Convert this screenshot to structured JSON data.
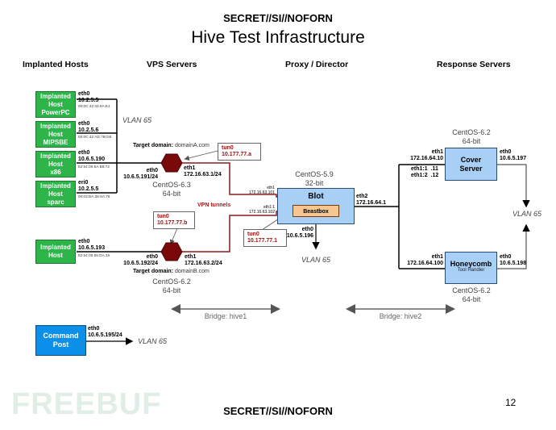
{
  "header": {
    "classification": "SECRET//SI//NOFORN",
    "title": "Hive Test Infrastructure"
  },
  "columns": {
    "implanted_hosts": "Implanted Hosts",
    "vps_servers": "VPS Servers",
    "proxy_director": "Proxy / Director",
    "response_servers": "Response Servers"
  },
  "implanted_hosts": [
    {
      "label": "Implanted Host PowerPC",
      "line1": "Implanted",
      "line2": "Host",
      "line3": "PowerPC",
      "iface": "eth0",
      "ip": "10.2.5.5",
      "mac": "00:0C:42:33:8A:E1"
    },
    {
      "label": "Implanted Host MIPSBE",
      "line1": "Implanted",
      "line2": "Host",
      "line3": "MIPSBE",
      "iface": "eth0",
      "ip": "10.2.5.6",
      "mac": "00:0C:42:AD:7B:DE"
    },
    {
      "label": "Implanted Host x86",
      "line1": "Implanted",
      "line2": "Host",
      "line3": "x86",
      "iface": "eth0",
      "ip": "10.6.5.190",
      "mac": "52:54:00:5A:B9:72"
    },
    {
      "label": "Implanted Host sparc",
      "line1": "Implanted",
      "line2": "Host",
      "line3": "sparc",
      "iface": "eri0",
      "ip": "10.2.5.5",
      "mac": "00:03:BA:36:5A:78"
    },
    {
      "label": "Implanted Host",
      "line1": "Implanted",
      "line2": "Host",
      "line3": "",
      "iface": "eth0",
      "ip": "10.6.5.193",
      "mac": "52:54:00:55:DA:16"
    }
  ],
  "vps": [
    {
      "target_label": "Target domain:",
      "target_domain": "domainA.com",
      "eth0_iface": "eth0",
      "eth0_ip": "10.6.5.191/24",
      "eth1_iface": "eth1",
      "eth1_ip": "172.16.63.1/24",
      "os": "CentOS-6.3",
      "arch": "64-bit",
      "tun_iface": "tun0",
      "tun_ip": "10.177.77.a"
    },
    {
      "target_label": "Target domain:",
      "target_domain": "domainB.com",
      "eth0_iface": "eth0",
      "eth0_ip": "10.6.5.192/24",
      "eth1_iface": "eth1",
      "eth1_ip": "172.16.63.2/24",
      "os": "CentOS-6.2",
      "arch": "64-bit",
      "tun_iface": "tun0",
      "tun_ip": "10.177.77.b"
    }
  ],
  "vlan_label": "VLAN 65",
  "vpn_tunnels_label": "VPN tunnels",
  "blot": {
    "name": "Blot",
    "inner": "Beastbox",
    "os": "CentOS-5.9",
    "arch": "32-bit",
    "eth1_iface": "eth1",
    "eth1_ip": "172.16.63.101",
    "eth11_iface": "eth1:1",
    "eth11_ip": "172.16.63.102",
    "eth2_iface": "eth2",
    "eth2_ip": "172.16.64.1",
    "eth0_iface": "eth0",
    "eth0_ip": "10.6.5.196",
    "tun_iface": "tun0",
    "tun_ip": "10.177.77.1"
  },
  "cover": {
    "line1": "Cover",
    "line2": "Server",
    "os": "CentOS-6.2",
    "arch": "64-bit",
    "eth1_iface": "eth1",
    "eth1_ip": "172.16.64.10",
    "alias1": "eth1:1",
    "alias1_ip": ".11",
    "alias2": "eth1:2",
    "alias2_ip": ".12",
    "eth0_iface": "eth0",
    "eth0_ip": "10.6.5.197"
  },
  "honeycomb": {
    "name": "Honeycomb",
    "sub": "Tool Handler",
    "os": "CentOS-6.2",
    "arch": "64-bit",
    "eth1_iface": "eth1",
    "eth1_ip": "172.16.64.100",
    "eth0_iface": "eth0",
    "eth0_ip": "10.6.5.198"
  },
  "bridges": {
    "hive1": "Bridge: hive1",
    "hive2": "Bridge: hive2"
  },
  "command_post": {
    "line1": "Command",
    "line2": "Post",
    "iface": "eth0",
    "ip": "10.6.5.195/24"
  },
  "footer": {
    "classification": "SECRET//SI//NOFORN",
    "page_number": "12",
    "watermark": "FREEBUF"
  },
  "colors": {
    "implant": "#2eb54a",
    "server": "#a8d0f5",
    "command_post": "#0b8fe8",
    "vps_hex": "#7a0a0a",
    "tunnel": "#b01818",
    "beastbox": "#f8c690"
  }
}
